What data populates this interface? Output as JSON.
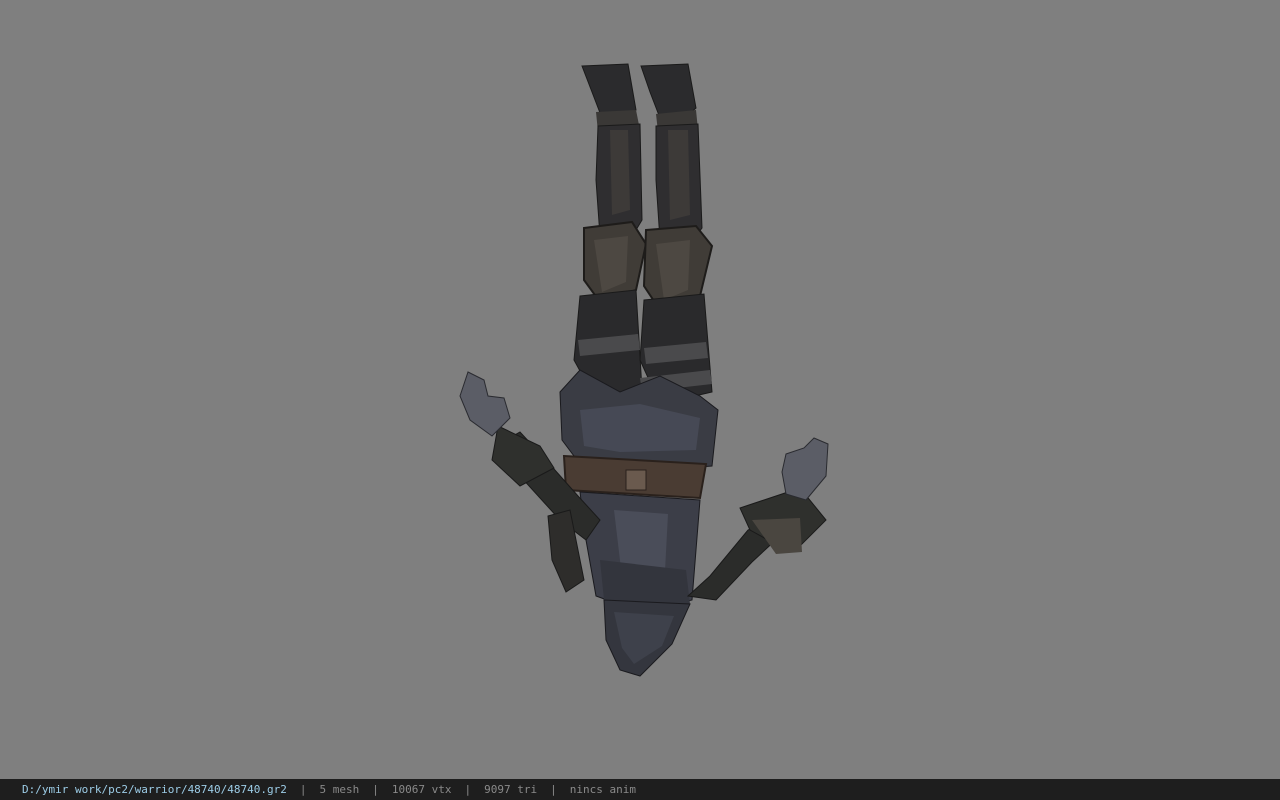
{
  "viewer": {
    "background_color": "#7f7f7f",
    "model_description": "upside-down armored character model"
  },
  "status": {
    "file_path": "D:/ymir work/pc2/warrior/48740/48740.gr2",
    "mesh_count": "5 mesh",
    "vertex_count": "10067 vtx",
    "triangle_count": "9097 tri",
    "animation": "nincs anim",
    "separator": "|"
  }
}
